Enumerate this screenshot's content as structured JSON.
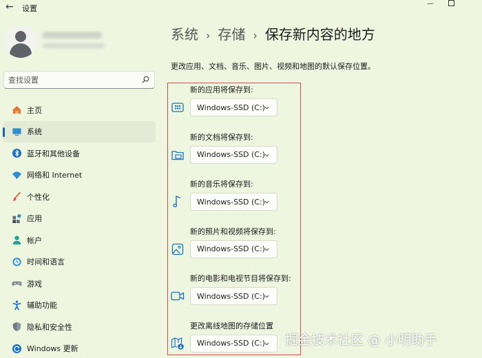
{
  "window": {
    "title": "设置",
    "back_icon": "arrow-left-icon"
  },
  "search": {
    "placeholder": "查找设置"
  },
  "nav": {
    "items": [
      {
        "label": "主页",
        "icon": "home-icon"
      },
      {
        "label": "系统",
        "icon": "monitor-icon",
        "active": true
      },
      {
        "label": "蓝牙和其他设备",
        "icon": "bluetooth-icon"
      },
      {
        "label": "网络和 Internet",
        "icon": "wifi-icon"
      },
      {
        "label": "个性化",
        "icon": "brush-icon"
      },
      {
        "label": "应用",
        "icon": "apps-icon"
      },
      {
        "label": "帐户",
        "icon": "person-icon"
      },
      {
        "label": "时间和语言",
        "icon": "clock-globe-icon"
      },
      {
        "label": "游戏",
        "icon": "gamepad-icon"
      },
      {
        "label": "辅助功能",
        "icon": "accessibility-icon"
      },
      {
        "label": "隐私和安全性",
        "icon": "shield-icon"
      },
      {
        "label": "Windows 更新",
        "icon": "update-icon"
      }
    ]
  },
  "breadcrumb": {
    "level1": "系统",
    "level2": "存储",
    "current": "保存新内容的地方",
    "separator": "›"
  },
  "description": "更改应用、文档、音乐、图片、视频和地图的默认保存位置。",
  "settings": [
    {
      "label": "新的应用将保存到:",
      "value": "Windows-SSD (C:)",
      "icon": "apps-storage-icon"
    },
    {
      "label": "新的文档将保存到:",
      "value": "Windows-SSD (C:)",
      "icon": "folder-document-icon"
    },
    {
      "label": "新的音乐将保存到:",
      "value": "Windows-SSD (C:)",
      "icon": "music-note-icon"
    },
    {
      "label": "新的照片和视频将保存到:",
      "value": "Windows-SSD (C:)",
      "icon": "image-icon"
    },
    {
      "label": "新的电影和电视节目将保存到:",
      "value": "Windows-SSD (C:)",
      "icon": "video-camera-icon"
    },
    {
      "label": "更改离线地图的存储位置",
      "value": "Windows-SSD (C:)",
      "icon": "map-download-icon"
    }
  ],
  "watermark": "掘金技术社区 @ 小明助手",
  "colors": {
    "background": "#eef6e0",
    "accent": "#0067c0",
    "highlight_border": "#d24a4a"
  }
}
